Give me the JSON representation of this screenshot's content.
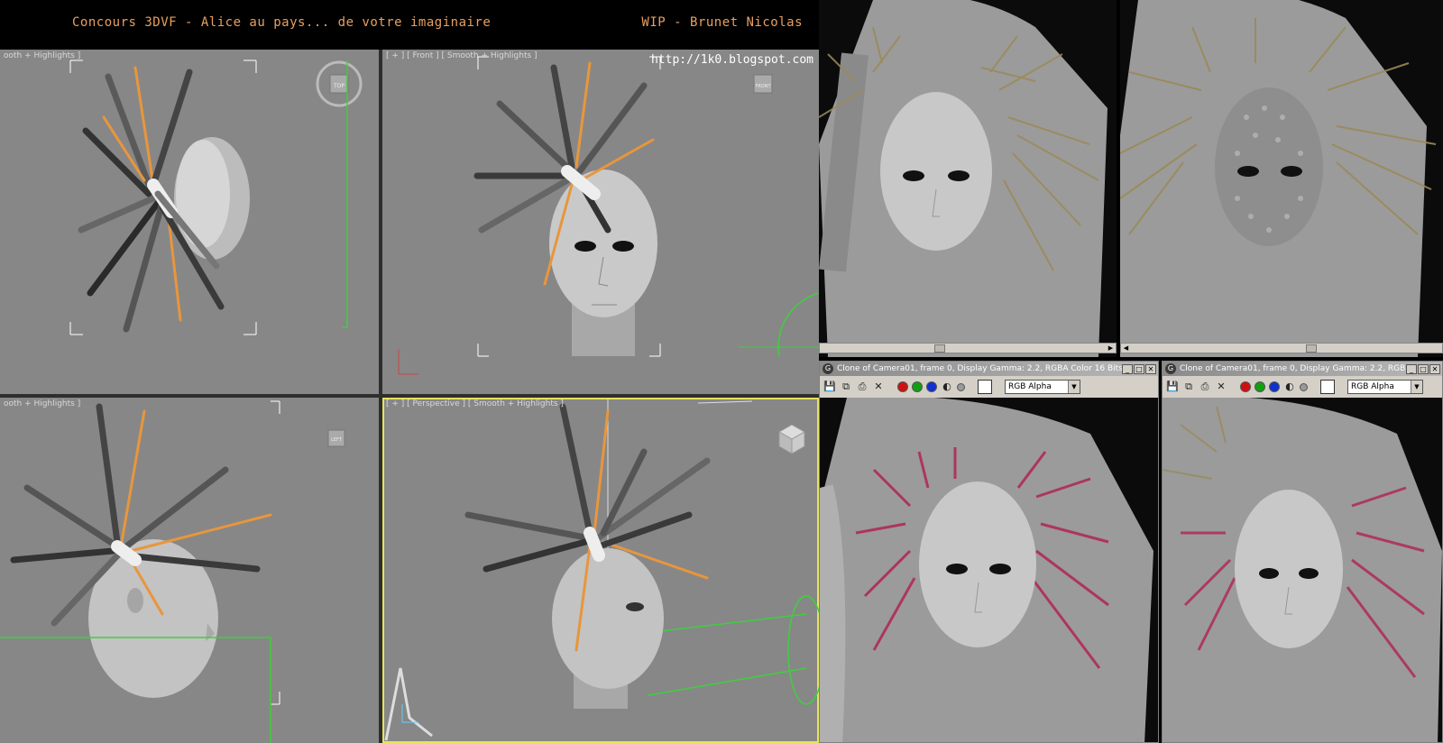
{
  "header": {
    "title_left": "Concours 3DVF - Alice au pays... de votre imaginaire",
    "title_right": "WIP - Brunet Nicolas",
    "url": "http://1k0.blogspot.com"
  },
  "viewports": {
    "top": {
      "label": "ooth + Highlights ]",
      "cube": "TOP"
    },
    "front": {
      "label": "[ + ] [ Front ] [ Smooth + Highlights ]",
      "cube": "FRONT"
    },
    "left": {
      "label": "ooth + Highlights ]",
      "cube": "LEFT"
    },
    "perspective": {
      "label": "[ + ] [ Perspective ] [ Smooth + Highlights ]"
    }
  },
  "render_windows": [
    {
      "title": "Clone of Camera01, frame 0, Display Gamma: 2.2, RGBA Color 16 Bits/...",
      "channel": "RGB Alpha"
    },
    {
      "title": "Clone of Camera01, frame 0, Display Gamma: 2.2, RGB...",
      "channel": "RGB Alpha"
    }
  ],
  "colors": {
    "hair_orange": "#e8963c",
    "hair_blonde": "#9a8a58",
    "hair_pink": "#b02a5a",
    "viewport_bg": "#878787",
    "accent_yellow": "#e6e35a"
  }
}
